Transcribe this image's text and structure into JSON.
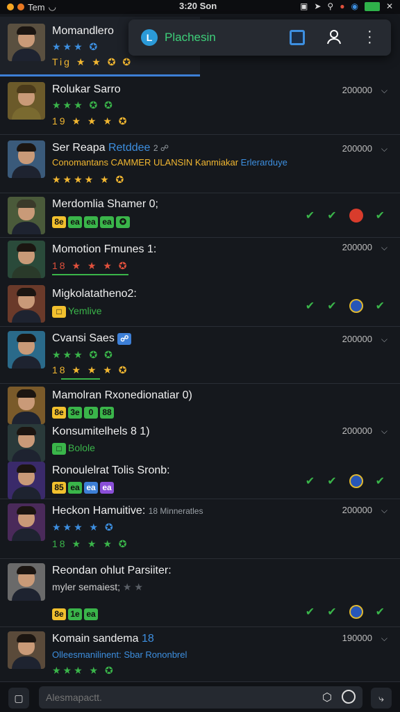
{
  "statusbar": {
    "app": "Tem",
    "time": "3:20 Son"
  },
  "popup": {
    "label": "Plachesin"
  },
  "rows": [
    {
      "name": "Momandlero",
      "stars": "★★★ ✪",
      "extra": "Tig ★ ★ ✪ ✪",
      "stat": ""
    },
    {
      "name": "Rolukar Sarro",
      "stars": "★★★ ✪ ✪",
      "extra": "19 ★ ★ ★ ✪",
      "stat": "200000"
    },
    {
      "name": "Ser Reapa",
      "tag": "Retddee",
      "meta": "2 ☍",
      "line2": "Conomantans CAMMER ULANSIN Kanmiakar",
      "line2b": "Erlerarduye",
      "stars": "★★★★ ★ ✪",
      "stat": "200000"
    },
    {
      "name": "Merdomlia Shamer 0;",
      "pills": [
        "8e",
        "ea",
        "ea",
        "ea",
        "✪"
      ],
      "stat": ""
    },
    {
      "name": "Momotion Fmunes 1:",
      "stars": "18 ★ ★ ★ ✪",
      "stat": "200000"
    },
    {
      "name": "Migkolatatheno2:",
      "pill": "Yemlive",
      "stat": ""
    },
    {
      "name": "Cvansi Saes",
      "stars": "★★★ ✪ ✪",
      "extra": "18 ★ ★ ★ ✪",
      "stat": "200000"
    },
    {
      "name": "Mamolran Rxonedionatiar 0)",
      "pills": [
        "8e",
        "3e",
        "0",
        "88"
      ],
      "stat": ""
    },
    {
      "name": "Konsumitelhels 8 1)",
      "pill": "Bolole",
      "stat": "200000"
    },
    {
      "name": "Ronoulelrat Tolis Sronb:",
      "pills": [
        "85",
        "ea",
        "ea",
        "ea"
      ],
      "stat": ""
    },
    {
      "name": "Heckon Hamuitive:",
      "meta": "18 Minneratles",
      "stars": "★★★ ★ ✪",
      "extra": "18 ★ ★ ★ ✪",
      "stat": "200000"
    },
    {
      "name": "Reondan ohlut Parsiiter:",
      "line2": "myler semaiest;",
      "stars": "★ ★",
      "pills": [
        "8e",
        "1e",
        "ea"
      ],
      "stat": ""
    },
    {
      "name": "Komain sandema",
      "meta": "18",
      "line2": "Olleesmanilinent: Sbar Rononbrel",
      "stars": "★★★ ★ ✪",
      "stat": "190000"
    }
  ],
  "bottombar": {
    "placeholder": "Alesmapactt."
  }
}
